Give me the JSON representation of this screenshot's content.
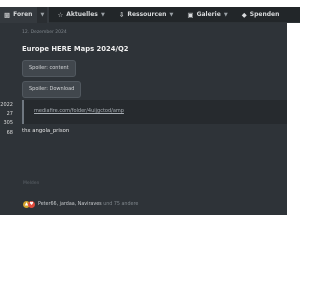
{
  "nav": {
    "items": [
      {
        "label": "Foren",
        "icon": "chat-bubbles-icon"
      },
      {
        "label": "Aktuelles",
        "icon": "star-icon"
      },
      {
        "label": "Ressourcen",
        "icon": "download-icon"
      },
      {
        "label": "Galerie",
        "icon": "image-icon"
      },
      {
        "label": "Spenden",
        "icon": "tag-icon"
      }
    ]
  },
  "post": {
    "date": "12. Dezember 2024",
    "title": "Europe HERE Maps 2024/Q2",
    "spoilers": [
      "Spoiler: content",
      "Spoiler: Download"
    ],
    "quote_link": "mediafire.com/folder/4uijgctod/amp",
    "body": "thx angola_prison",
    "footer_text": "Melden",
    "reactions": {
      "names": "Peter66, jardaa, Naviraves",
      "more": "und 75 andere"
    }
  },
  "stats": [
    "2022",
    "27",
    "305",
    "68"
  ],
  "colors": {
    "nav_bg": "#222629",
    "content_bg": "#2e3338",
    "accent_like": "#d2a32c",
    "accent_love": "#e04b3c"
  }
}
